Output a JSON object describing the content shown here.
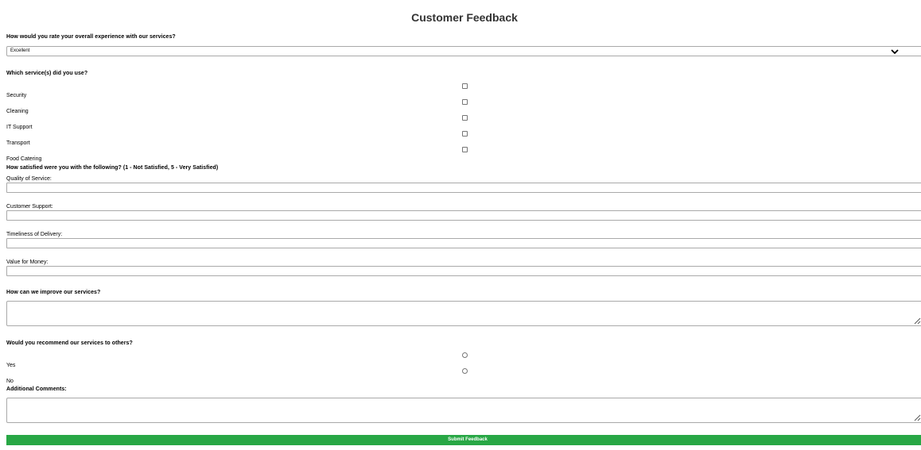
{
  "form": {
    "title": "Customer Feedback",
    "q_overall": "How would you rate your overall experience with our services?",
    "overall_selected": "Excellent",
    "q_services": "Which service(s) did you use?",
    "services": [
      "Security",
      "Cleaning",
      "IT Support",
      "Transport",
      "Food Catering"
    ],
    "q_satisfaction": "How satisfied were you with the following? (1 - Not Satisfied, 5 - Very Satisfied)",
    "ratings": [
      "Quality of Service:",
      "Customer Support:",
      "Timeliness of Delivery:",
      "Value for Money:"
    ],
    "q_improve": "How can we improve our services?",
    "q_recommend": "Would you recommend our services to others?",
    "recommend_options": [
      "Yes",
      "No"
    ],
    "q_comments": "Additional Comments:",
    "submit_label": "Submit Feedback"
  },
  "colors": {
    "submit_bg": "#28a745",
    "title_text": "#333333"
  },
  "icons": {
    "select_arrow": "chevron-down-icon",
    "resize_grip": "resize-grip-icon"
  }
}
